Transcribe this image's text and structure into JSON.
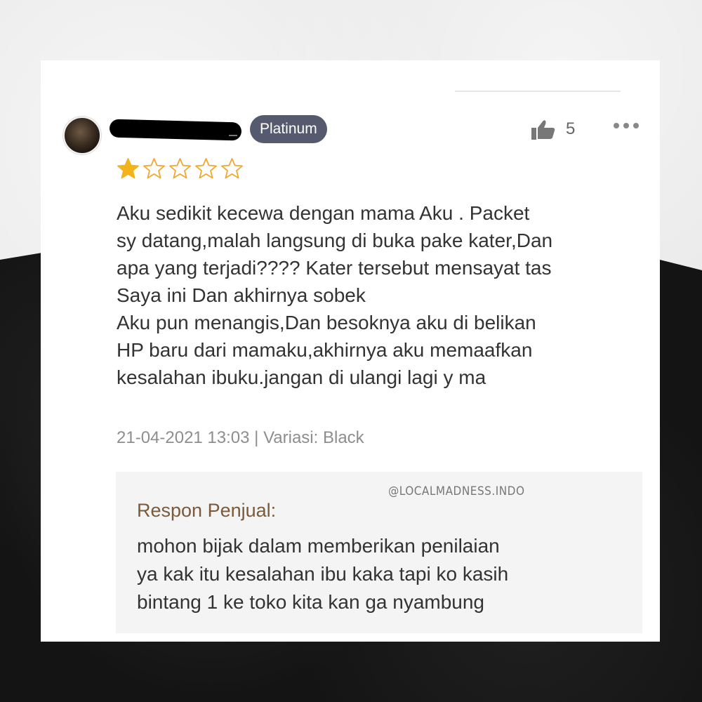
{
  "review": {
    "badge": "Platinum",
    "like_count": "5",
    "rating": 1,
    "rating_max": 5,
    "lines": [
      "Aku sedikit kecewa dengan mama Aku . Packet",
      "sy datang,malah langsung di buka pake kater,Dan",
      "apa yang terjadi???? Kater tersebut mensayat tas",
      "Saya ini Dan akhirnya sobek",
      "Aku pun menangis,Dan besoknya aku di belikan",
      "HP baru dari mamaku,akhirnya aku memaafkan",
      "kesalahan ibuku.jangan di ulangi lagi y ma"
    ],
    "meta": "21-04-2021 13:03 | Variasi: Black"
  },
  "seller_response": {
    "watermark": "@LOCALMADNESS.INDO",
    "label": "Respon Penjual:",
    "lines": [
      "mohon bijak dalam memberikan penilaian",
      "ya kak itu kesalahan ibu kaka tapi ko kasih",
      "bintang 1 ke toko kita kan ga nyambung"
    ]
  },
  "colors": {
    "badge_bg": "#565a6f",
    "star_filled": "#f3b31b",
    "star_empty": "#f0a830",
    "seller_label": "#7a5a3a",
    "seller_box_bg": "#f4f4f4"
  },
  "icons": {
    "like": "thumbs-up-icon",
    "more": "more-horizontal-icon",
    "star": "star-icon"
  }
}
